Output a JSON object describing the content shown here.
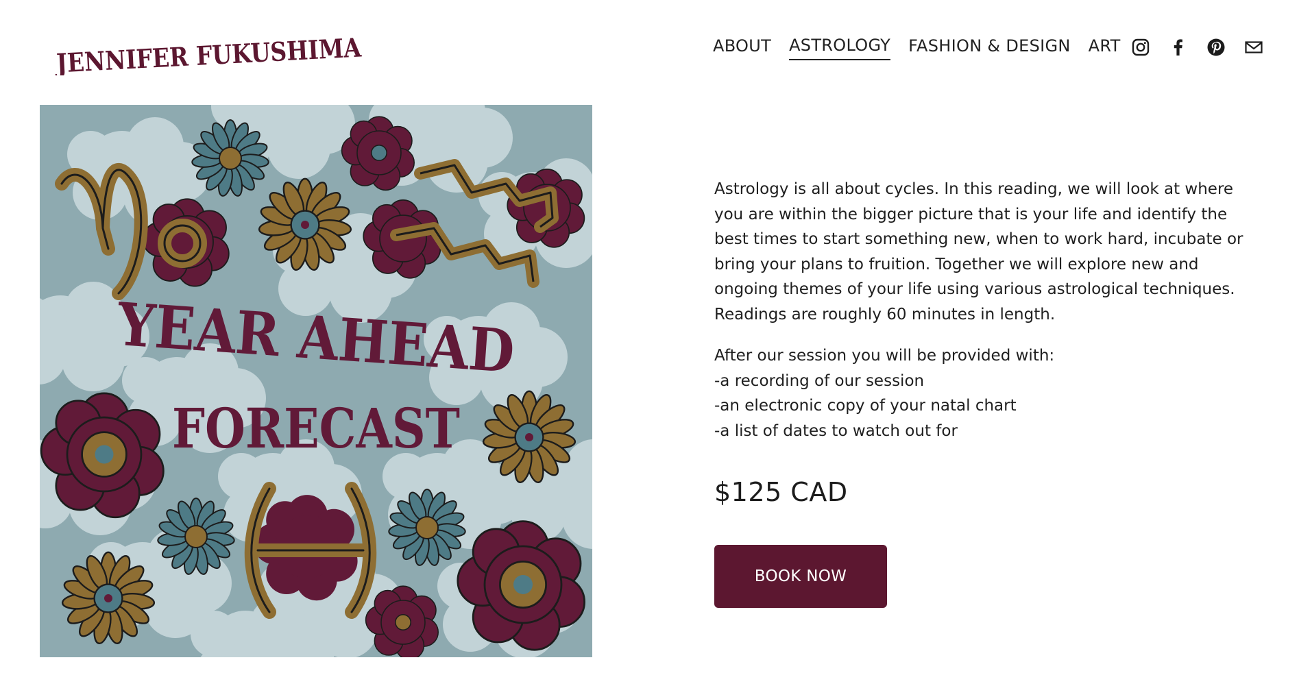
{
  "site": {
    "logo_text": "JENNIFER FUKUSHIMA"
  },
  "nav": {
    "items": [
      {
        "label": "ABOUT",
        "active": false
      },
      {
        "label": "ASTROLOGY",
        "active": true
      },
      {
        "label": "FASHION & DESIGN",
        "active": false
      },
      {
        "label": "ART",
        "active": false
      }
    ]
  },
  "social": [
    "instagram-icon",
    "facebook-icon",
    "pinterest-icon",
    "email-icon"
  ],
  "product_image": {
    "line1": "YEAR AHEAD",
    "line2": "FORECAST",
    "colors": {
      "background": "#8eaab0",
      "cloud": "#c2d3d7",
      "burgundy": "#611a38",
      "mustard": "#8e6e33",
      "teal": "#4e7b86"
    }
  },
  "product": {
    "description": "Astrology is all about cycles. In this reading, we will look at where you are within the bigger picture that is your life and identify the best times to start something new, when to work hard, incubate or bring your plans to fruition. Together we will explore new and ongoing themes of your life using various astrological techniques. Readings are roughly 60 minutes in length.",
    "intro": "After our session you will be provided with:",
    "benefits": [
      "-a recording of our session",
      "-an electronic copy of your natal chart",
      "-a list of dates to watch out for"
    ],
    "price": "$125 CAD",
    "cta_label": "BOOK NOW"
  },
  "colors": {
    "accent": "#5c1730",
    "text": "#1f1f1f"
  }
}
